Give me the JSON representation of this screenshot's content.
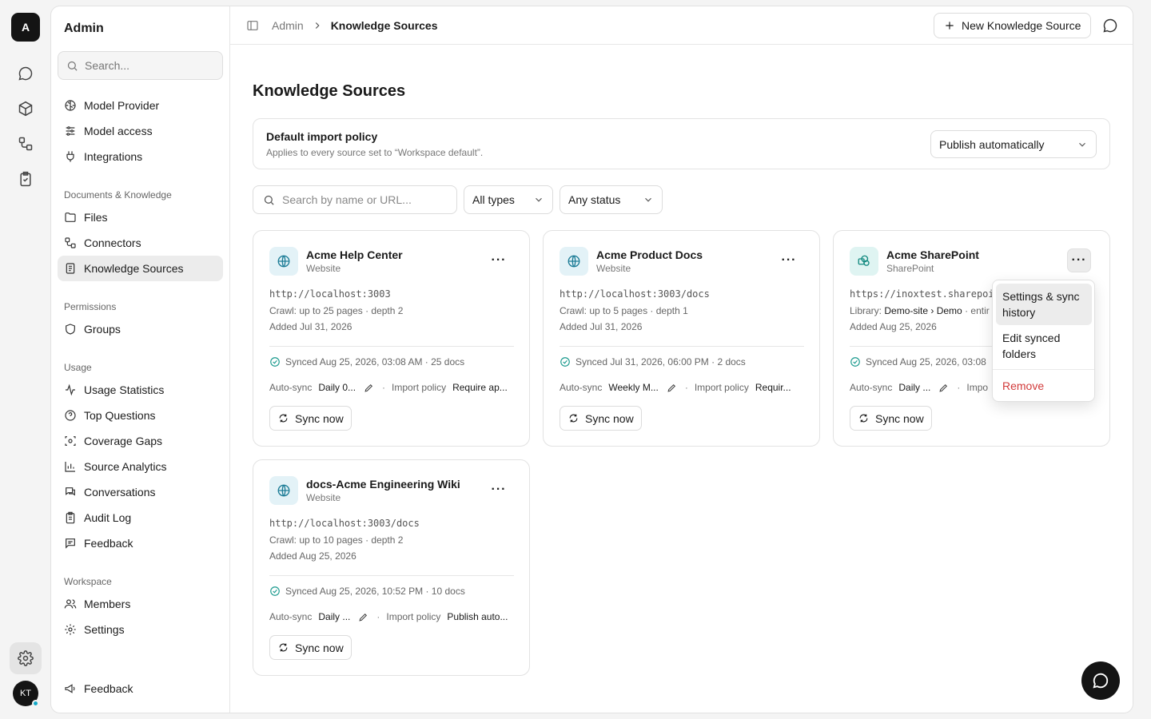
{
  "rail": {
    "workspace_initial": "A",
    "avatar_initials": "KT"
  },
  "sidebar": {
    "title": "Admin",
    "search_placeholder": "Search...",
    "top_items": [
      {
        "label": "Model Provider",
        "icon": "brain-icon"
      },
      {
        "label": "Model access",
        "icon": "sliders-icon"
      },
      {
        "label": "Integrations",
        "icon": "plug-icon"
      }
    ],
    "sections": [
      {
        "label": "Documents & Knowledge",
        "items": [
          {
            "label": "Files",
            "icon": "folder-icon"
          },
          {
            "label": "Connectors",
            "icon": "connectors-icon"
          },
          {
            "label": "Knowledge Sources",
            "icon": "book-icon",
            "active": true
          }
        ]
      },
      {
        "label": "Permissions",
        "items": [
          {
            "label": "Groups",
            "icon": "shield-icon"
          }
        ]
      },
      {
        "label": "Usage",
        "items": [
          {
            "label": "Usage Statistics",
            "icon": "activity-icon"
          },
          {
            "label": "Top Questions",
            "icon": "help-circle-icon"
          },
          {
            "label": "Coverage Gaps",
            "icon": "scan-icon"
          },
          {
            "label": "Source Analytics",
            "icon": "bar-chart-icon"
          },
          {
            "label": "Conversations",
            "icon": "messages-icon"
          },
          {
            "label": "Audit Log",
            "icon": "clipboard-icon"
          },
          {
            "label": "Feedback",
            "icon": "message-square-icon"
          }
        ]
      },
      {
        "label": "Workspace",
        "items": [
          {
            "label": "Members",
            "icon": "users-icon"
          },
          {
            "label": "Settings",
            "icon": "gear-icon"
          }
        ]
      }
    ],
    "bottom_feedback": "Feedback"
  },
  "header": {
    "breadcrumb": [
      "Admin",
      "Knowledge Sources"
    ],
    "new_button": "New Knowledge Source"
  },
  "page": {
    "title": "Knowledge Sources",
    "policy": {
      "title": "Default import policy",
      "description": "Applies to every source set to “Workspace default”.",
      "selected": "Publish automatically"
    },
    "filters": {
      "search_placeholder": "Search by name or URL...",
      "type": "All types",
      "status": "Any status"
    }
  },
  "cards": [
    {
      "name": "Acme Help Center",
      "type": "Website",
      "url": "http://localhost:3003",
      "line2": "Crawl: up to 25 pages · depth 2",
      "added": "Added Jul 31, 2026",
      "synced": "Synced Aug 25, 2026, 03:08 AM · 25 docs",
      "auto_label": "Auto-sync",
      "auto_value": "Daily 0...",
      "policy_label": "Import policy",
      "policy_value": "Require ap...",
      "sync_button": "Sync now"
    },
    {
      "name": "Acme Product Docs",
      "type": "Website",
      "url": "http://localhost:3003/docs",
      "line2": "Crawl: up to 5 pages · depth 1",
      "added": "Added Jul 31, 2026",
      "synced": "Synced Jul 31, 2026, 06:00 PM · 2 docs",
      "auto_label": "Auto-sync",
      "auto_value": "Weekly M...",
      "policy_label": "Import policy",
      "policy_value": "Requir...",
      "sync_button": "Sync now"
    },
    {
      "name": "Acme SharePoint",
      "type": "SharePoint",
      "url": "https://inoxtest.sharepoi",
      "library_label": "Library:",
      "library_value": "Demo-site › Demo",
      "library_tail": "· entir",
      "added": "Added Aug 25, 2026",
      "synced": "Synced Aug 25, 2026, 03:08",
      "auto_label": "Auto-sync",
      "auto_value": "Daily ...",
      "policy_label": "Impo",
      "sync_button": "Sync now"
    },
    {
      "name": "docs-Acme Engineering Wiki",
      "type": "Website",
      "url": "http://localhost:3003/docs",
      "line2": "Crawl: up to 10 pages · depth 2",
      "added": "Added Aug 25, 2026",
      "synced": "Synced Aug 25, 2026, 10:52 PM · 10 docs",
      "auto_label": "Auto-sync",
      "auto_value": "Daily ...",
      "policy_label": "Import policy",
      "policy_value": "Publish auto...",
      "sync_button": "Sync now"
    }
  ],
  "menu": {
    "item1": "Settings & sync history",
    "item2": "Edit synced folders",
    "item3": "Remove"
  },
  "colors": {
    "accent_teal": "#1d9b8f",
    "danger": "#d23b3b",
    "dark": "#141414"
  }
}
